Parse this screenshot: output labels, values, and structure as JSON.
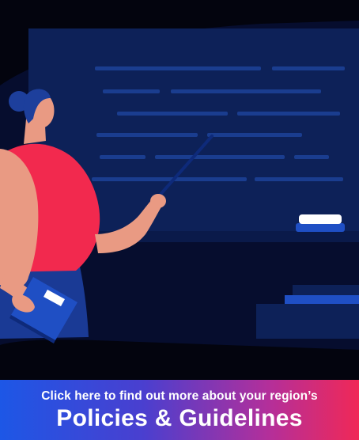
{
  "banner": {
    "subtitle": "Click here to find out more about your region’s",
    "title": "Policies & Guidelines"
  },
  "colors": {
    "background": "#03040e",
    "chalkboard": "#0d2158",
    "chalk_lines": "#1a3d8f",
    "accent_blue": "#1f4fc4",
    "shirt": "#f2294e",
    "skin": "#e99a83",
    "hair": "#1d3f9c",
    "gradient_start": "#1d57e6",
    "gradient_end": "#f02857"
  },
  "icons": {
    "teacher": "teacher-illustration",
    "chalkboard": "chalkboard",
    "book": "book-icon",
    "eraser": "eraser-icon",
    "pointer": "pointer-stick"
  }
}
